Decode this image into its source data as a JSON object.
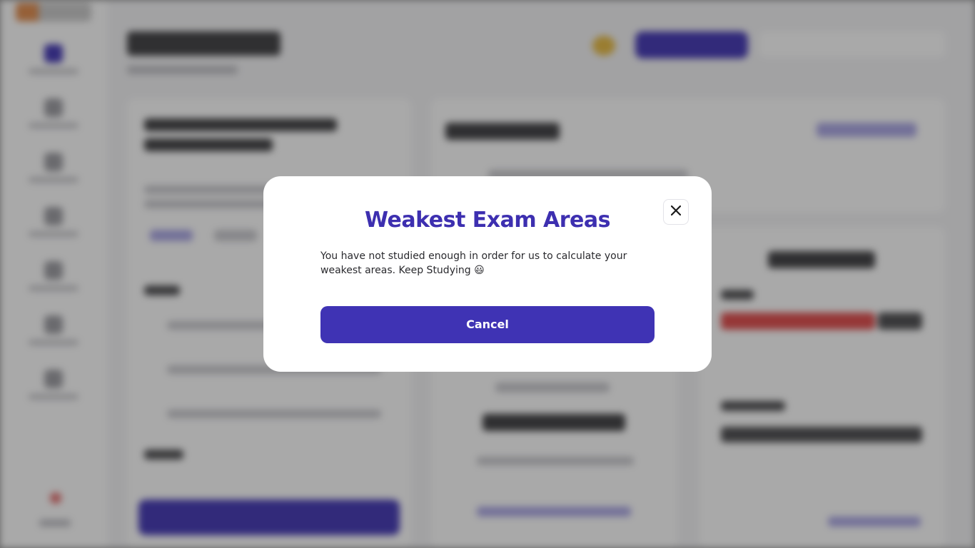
{
  "modal": {
    "title": "Weakest Exam Areas",
    "message": "You have not studied enough in order for us to calculate your weakest areas. Keep Studying 😃",
    "cancel_label": "Cancel",
    "close_icon": "close-icon"
  },
  "colors": {
    "accent": "#3f33b4",
    "title": "#3d2fb0",
    "overlay": "rgba(30,30,30,0.38)",
    "danger": "#e04848"
  }
}
